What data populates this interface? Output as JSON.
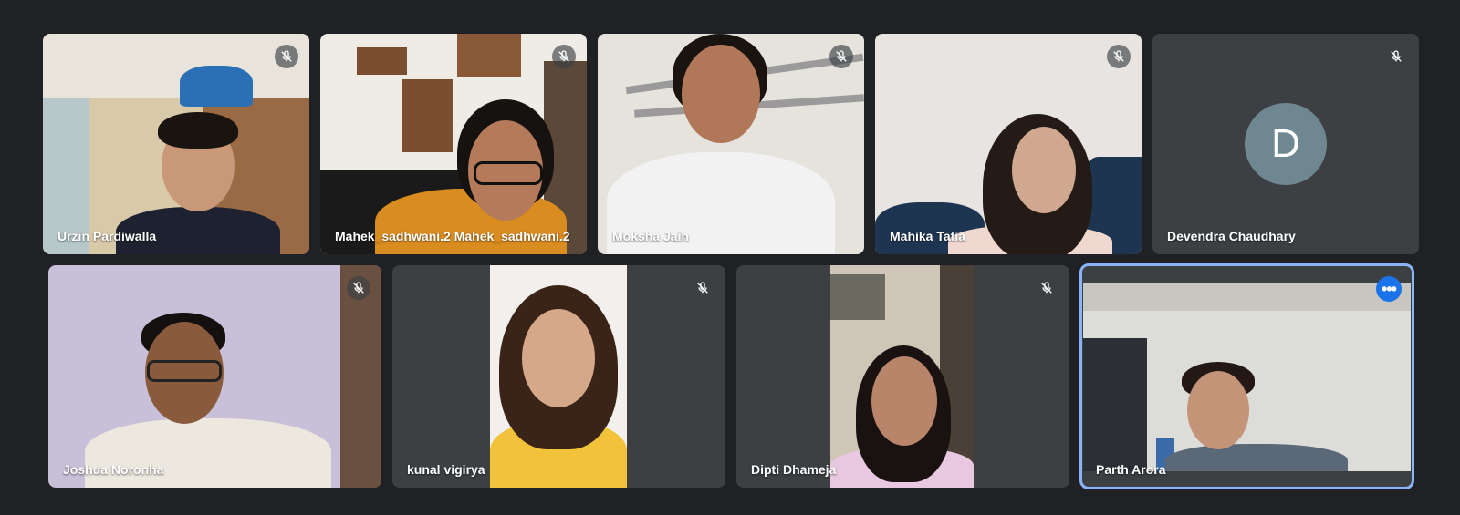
{
  "meeting": {
    "row1": [
      {
        "name": "Urzin Pardiwalla"
      },
      {
        "name": "Mahek_sadhwani.2 Mahek_sadhwani.2"
      },
      {
        "name": "Moksha Jain"
      },
      {
        "name": "Mahika Tatia"
      },
      {
        "name": "Devendra Chaudhary",
        "avatar_letter": "D"
      }
    ],
    "row2": [
      {
        "name": "Joshua Noronha"
      },
      {
        "name": "kunal vigirya"
      },
      {
        "name": "Dipti Dhameja"
      },
      {
        "name": "Parth Arora",
        "more_label": "•••"
      }
    ]
  },
  "colors": {
    "background": "#202124",
    "tile": "#3c4043",
    "avatar": "#6f8791",
    "active_border": "#8ab4f8",
    "more_button": "#1a73e8"
  },
  "icons": {
    "mute": "mic-off-icon",
    "more": "more-options-icon"
  }
}
